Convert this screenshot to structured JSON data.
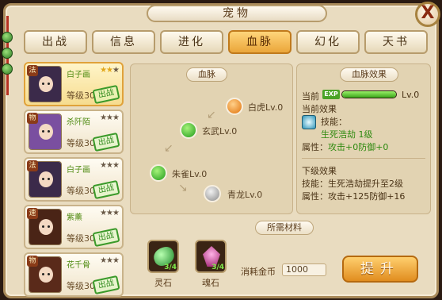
{
  "window": {
    "title": "宠物",
    "close_label": "X"
  },
  "tabs": [
    {
      "label": "出战",
      "active": false
    },
    {
      "label": "信息",
      "active": false
    },
    {
      "label": "进化",
      "active": false
    },
    {
      "label": "血脉",
      "active": true
    },
    {
      "label": "幻化",
      "active": false
    },
    {
      "label": "天书",
      "active": false
    }
  ],
  "pets": [
    {
      "tag": "法",
      "name": "白子画",
      "stars_on": "★★",
      "stars_off": "★",
      "level": "等级30",
      "stamp": "出战",
      "hair": "#3b2a4a"
    },
    {
      "tag": "物",
      "name": "杀阡陌",
      "stars_on": "",
      "stars_off": "★★★",
      "level": "等级30",
      "stamp": "出战",
      "hair": "#7a4fa0"
    },
    {
      "tag": "法",
      "name": "白子画",
      "stars_on": "",
      "stars_off": "★★★",
      "level": "等级30",
      "stamp": "出战",
      "hair": "#3b2a4a"
    },
    {
      "tag": "速",
      "name": "紫薰",
      "stars_on": "",
      "stars_off": "★★★",
      "level": "等级30",
      "stamp": "出战",
      "hair": "#4a2416"
    },
    {
      "tag": "物",
      "name": "花千骨",
      "stars_on": "",
      "stars_off": "★★★",
      "level": "等级30",
      "stamp": "出战",
      "hair": "#5a2a1a"
    }
  ],
  "bloodline": {
    "label": "血脉",
    "nodes": {
      "white_tiger": "白虎Lv.0",
      "black_tortoise": "玄武Lv.0",
      "vermilion_bird": "朱雀Lv.0",
      "azure_dragon": "青龙Lv.0"
    }
  },
  "effect": {
    "label": "血脉效果",
    "current_prefix": "当前",
    "exp_badge": "EXP",
    "exp_progress": 1.0,
    "current_level": "Lv.0",
    "current_effect_title": "当前效果",
    "skill_title": "技能：",
    "skill_value": "生死浩劫 1级",
    "attr_label": "属性：",
    "attr_value": "攻击+0防御+0",
    "next_title": "下级效果",
    "next_skill": "技能：生死浩劫提升至2级",
    "next_attr": "属性：攻击+125防御+16"
  },
  "materials": {
    "label": "所需材料",
    "items": [
      {
        "name": "灵石",
        "count": "3/4",
        "color": "#3cc24a"
      },
      {
        "name": "魂石",
        "count": "3/4",
        "color": "#c23a8e"
      }
    ],
    "cost_label": "消耗金币",
    "cost_value": "1000",
    "upgrade_label": "提升"
  }
}
